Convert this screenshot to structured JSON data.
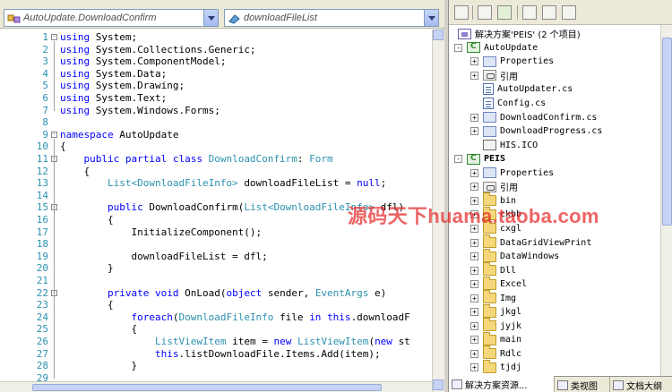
{
  "editor": {
    "class_combo": "AutoUpdate.DownloadConfirm",
    "member_combo": "downloadFileList",
    "lines": [
      {
        "n": "1",
        "fold": "-",
        "segs": [
          [
            "kw",
            "using"
          ],
          [
            "",
            "System;"
          ]
        ]
      },
      {
        "n": "2",
        "segs": [
          [
            "kw",
            "using"
          ],
          [
            "",
            "System.Collections.Generic;"
          ]
        ]
      },
      {
        "n": "3",
        "segs": [
          [
            "kw",
            "using"
          ],
          [
            "",
            "System.ComponentModel;"
          ]
        ]
      },
      {
        "n": "4",
        "segs": [
          [
            "kw",
            "using"
          ],
          [
            "",
            "System.Data;"
          ]
        ]
      },
      {
        "n": "5",
        "segs": [
          [
            "kw",
            "using"
          ],
          [
            "",
            "System.Drawing;"
          ]
        ]
      },
      {
        "n": "6",
        "segs": [
          [
            "kw",
            "using"
          ],
          [
            "",
            "System.Text;"
          ]
        ]
      },
      {
        "n": "7",
        "segs": [
          [
            "kw",
            "using"
          ],
          [
            "",
            "System.Windows.Forms;"
          ]
        ]
      },
      {
        "n": "8",
        "segs": []
      },
      {
        "n": "9",
        "fold": "-",
        "segs": [
          [
            "kw",
            "namespace"
          ],
          [
            "",
            "AutoUpdate"
          ]
        ]
      },
      {
        "n": "10",
        "segs": [
          [
            "",
            "{"
          ]
        ]
      },
      {
        "n": "11",
        "fold": "-",
        "segs": [
          [
            "",
            "    "
          ],
          [
            "kw",
            "public partial class"
          ],
          [
            "ty",
            "DownloadConfirm"
          ],
          [
            "",
            ":"
          ],
          [
            "ty",
            "Form"
          ]
        ]
      },
      {
        "n": "12",
        "segs": [
          [
            "",
            "    {"
          ]
        ]
      },
      {
        "n": "13",
        "segs": [
          [
            "",
            "        "
          ],
          [
            "ty",
            "List<DownloadFileInfo>"
          ],
          [
            "",
            "downloadFileList ="
          ],
          [
            "kw",
            "null"
          ],
          [
            "",
            ";"
          ]
        ]
      },
      {
        "n": "14",
        "segs": []
      },
      {
        "n": "15",
        "fold": "-",
        "segs": [
          [
            "",
            "        "
          ],
          [
            "kw",
            "public"
          ],
          [
            "",
            "DownloadConfirm("
          ],
          [
            "ty",
            "List<DownloadFileInfo>"
          ],
          [
            "",
            "dfl)"
          ]
        ]
      },
      {
        "n": "16",
        "segs": [
          [
            "",
            "        {"
          ]
        ]
      },
      {
        "n": "17",
        "segs": [
          [
            "",
            "            InitializeComponent();"
          ]
        ]
      },
      {
        "n": "18",
        "segs": []
      },
      {
        "n": "19",
        "segs": [
          [
            "",
            "            downloadFileList = dfl;"
          ]
        ]
      },
      {
        "n": "20",
        "segs": [
          [
            "",
            "        }"
          ]
        ]
      },
      {
        "n": "21",
        "segs": []
      },
      {
        "n": "22",
        "fold": "-",
        "segs": [
          [
            "",
            "        "
          ],
          [
            "kw",
            "private void"
          ],
          [
            "",
            "OnLoad("
          ],
          [
            "kw",
            "object"
          ],
          [
            "",
            "sender,"
          ],
          [
            "ty",
            "EventArgs"
          ],
          [
            "",
            "e)"
          ]
        ]
      },
      {
        "n": "23",
        "segs": [
          [
            "",
            "        {"
          ]
        ]
      },
      {
        "n": "24",
        "segs": [
          [
            "",
            "            "
          ],
          [
            "kw",
            "foreach"
          ],
          [
            "",
            "("
          ],
          [
            "ty",
            "DownloadFileInfo"
          ],
          [
            "",
            "file"
          ],
          [
            "kw",
            "in"
          ],
          [
            "kw",
            "this"
          ],
          [
            "",
            ".downloadF"
          ]
        ]
      },
      {
        "n": "25",
        "segs": [
          [
            "",
            "            {"
          ]
        ]
      },
      {
        "n": "26",
        "segs": [
          [
            "",
            "                "
          ],
          [
            "ty",
            "ListViewItem"
          ],
          [
            "",
            "item ="
          ],
          [
            "kw",
            "new"
          ],
          [
            "ty",
            "ListViewItem"
          ],
          [
            "",
            "("
          ],
          [
            "kw",
            "new"
          ],
          [
            "",
            "st"
          ]
        ]
      },
      {
        "n": "27",
        "segs": [
          [
            "",
            "                "
          ],
          [
            "kw",
            "this"
          ],
          [
            "",
            ".listDownloadFile.Items.Add(item);"
          ]
        ]
      },
      {
        "n": "28",
        "segs": [
          [
            "",
            "            }"
          ]
        ]
      },
      {
        "n": "29",
        "segs": []
      }
    ]
  },
  "explorer": {
    "tree": [
      {
        "label": "解决方案'PEIS' (2 个项目)",
        "icon": "solution-icon",
        "level": 0,
        "exp": ""
      },
      {
        "label": "AutoUpdate",
        "icon": "csproject-icon",
        "level": 1,
        "exp": "-"
      },
      {
        "label": "Properties",
        "icon": "properties-icon",
        "level": 2,
        "exp": "+"
      },
      {
        "label": "引用",
        "icon": "references-icon",
        "level": 2,
        "exp": "+"
      },
      {
        "label": "AutoUpdater.cs",
        "icon": "cs-file-icon",
        "level": 2,
        "exp": ""
      },
      {
        "label": "Config.cs",
        "icon": "cs-file-icon",
        "level": 2,
        "exp": ""
      },
      {
        "label": "DownloadConfirm.cs",
        "icon": "form-file-icon",
        "level": 2,
        "exp": "+"
      },
      {
        "label": "DownloadProgress.cs",
        "icon": "form-file-icon",
        "level": 2,
        "exp": "+"
      },
      {
        "label": "HIS.ICO",
        "icon": "ico-file-icon",
        "level": 2,
        "exp": ""
      },
      {
        "label": "PEIS",
        "icon": "csproject-icon",
        "level": 1,
        "exp": "-",
        "bold": true
      },
      {
        "label": "Properties",
        "icon": "properties-icon",
        "level": 2,
        "exp": "+"
      },
      {
        "label": "引用",
        "icon": "references-icon",
        "level": 2,
        "exp": "+"
      },
      {
        "label": "bin",
        "icon": "folder-icon",
        "level": 2,
        "exp": "+"
      },
      {
        "label": "ckbb",
        "icon": "folder-icon",
        "level": 2,
        "exp": "+"
      },
      {
        "label": "cxgl",
        "icon": "folder-icon",
        "level": 2,
        "exp": "+"
      },
      {
        "label": "DataGridViewPrint",
        "icon": "folder-icon",
        "level": 2,
        "exp": "+"
      },
      {
        "label": "DataWindows",
        "icon": "folder-icon",
        "level": 2,
        "exp": "+"
      },
      {
        "label": "Dll",
        "icon": "folder-icon",
        "level": 2,
        "exp": "+"
      },
      {
        "label": "Excel",
        "icon": "folder-icon",
        "level": 2,
        "exp": "+"
      },
      {
        "label": "Img",
        "icon": "folder-icon",
        "level": 2,
        "exp": "+"
      },
      {
        "label": "jkgl",
        "icon": "folder-icon",
        "level": 2,
        "exp": "+"
      },
      {
        "label": "jyjk",
        "icon": "folder-icon",
        "level": 2,
        "exp": "+"
      },
      {
        "label": "main",
        "icon": "folder-icon",
        "level": 2,
        "exp": "+"
      },
      {
        "label": "Rdlc",
        "icon": "folder-icon",
        "level": 2,
        "exp": "+"
      },
      {
        "label": "tjdj",
        "icon": "folder-icon",
        "level": 2,
        "exp": "+"
      }
    ],
    "tabs": [
      {
        "label": "解决方案资源...",
        "icon": "solution-explorer-tab-icon"
      },
      {
        "label": "类视图",
        "icon": "class-view-tab-icon"
      },
      {
        "label": "文档大纲",
        "icon": "document-outline-tab-icon"
      }
    ]
  },
  "watermark": "源码天下huama.taoba.com",
  "colors": {
    "keyword": "#0000ff",
    "type": "#2b91af",
    "line_number": "#2b91af",
    "watermark": "#e62828"
  }
}
